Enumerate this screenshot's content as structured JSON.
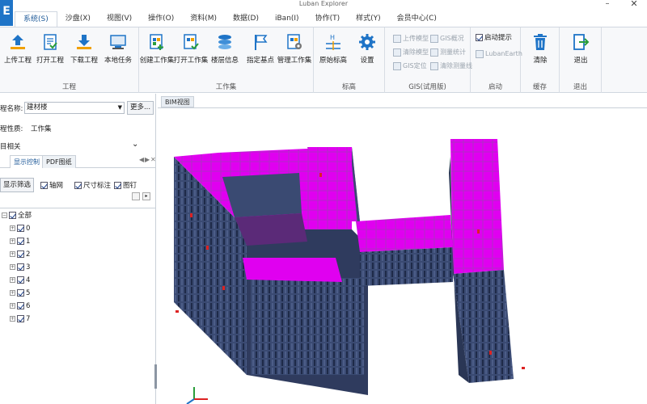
{
  "app": {
    "title": "Luban Explorer",
    "logo_glyph": "E"
  },
  "window": {
    "minimize_glyph": "–",
    "close_glyph": "✕"
  },
  "menu": {
    "tabs": [
      "系统(S)",
      "沙盘(X)",
      "视图(V)",
      "操作(O)",
      "资料(M)",
      "数据(D)",
      "iBan(I)",
      "协作(T)",
      "样式(Y)",
      "会员中心(C)"
    ],
    "active": "系统(S)"
  },
  "ribbon": {
    "groups": {
      "project": {
        "label": "工程",
        "buttons": [
          {
            "label": "上传工程",
            "icon": "upload-icon"
          },
          {
            "label": "打开工程",
            "icon": "open-project-icon"
          },
          {
            "label": "下载工程",
            "icon": "download-icon"
          },
          {
            "label": "本地任务",
            "icon": "local-task-icon"
          }
        ]
      },
      "workset": {
        "label": "工作集",
        "buttons": [
          {
            "label": "创建工作集",
            "icon": "create-workset-icon"
          },
          {
            "label": "打开工作集",
            "icon": "open-workset-icon"
          },
          {
            "label": "楼层信息",
            "icon": "floor-info-icon"
          },
          {
            "label": "指定基点",
            "icon": "flag-icon"
          },
          {
            "label": "管理工作集",
            "icon": "manage-workset-icon"
          }
        ]
      },
      "elevation": {
        "label": "标高",
        "buttons": [
          {
            "label": "原始标高",
            "icon": "elevation-icon"
          },
          {
            "label": "设置",
            "icon": "gear-icon"
          }
        ]
      },
      "gis": {
        "label": "GIS(试用版)",
        "buttons": [
          "上传模型",
          "清除模型",
          "GIS定位",
          "GIS概况",
          "测量统计",
          "清除测量线"
        ]
      },
      "startup": {
        "label": "启动",
        "checkbox_label": "启动提示",
        "checkbox_checked": true,
        "earth_label": "LubanEarth"
      },
      "cache": {
        "label": "缓存",
        "button": "清除"
      },
      "exit": {
        "label": "退出",
        "button": "退出"
      }
    }
  },
  "left_panel": {
    "project_name_label": "程名称:",
    "project_name_value": "建材楼",
    "more_button": "更多...",
    "project_nature_label": "程性质:",
    "project_nature_value": "工作集",
    "related_label": "目相关",
    "collapse_glyph": "⌄",
    "tabs": [
      "显示控制",
      "PDF图纸"
    ],
    "active_tab": "显示控制",
    "tab_nav": [
      "◀",
      "▶",
      "✕"
    ],
    "filter_button": "显示筛选",
    "filters": [
      {
        "label": "轴网",
        "checked": true
      },
      {
        "label": "尺寸标注",
        "checked": true
      },
      {
        "label": "图钉",
        "checked": true
      }
    ],
    "tree": {
      "root": "全部",
      "children": [
        "0",
        "1",
        "2",
        "3",
        "4",
        "5",
        "6",
        "7"
      ]
    }
  },
  "viewport": {
    "tab_label": "BIM视图"
  },
  "colors": {
    "slab": "#e000f0",
    "wall": "#3a4a72",
    "wall_dark": "#2a3655",
    "accent": "#1f74c7"
  }
}
